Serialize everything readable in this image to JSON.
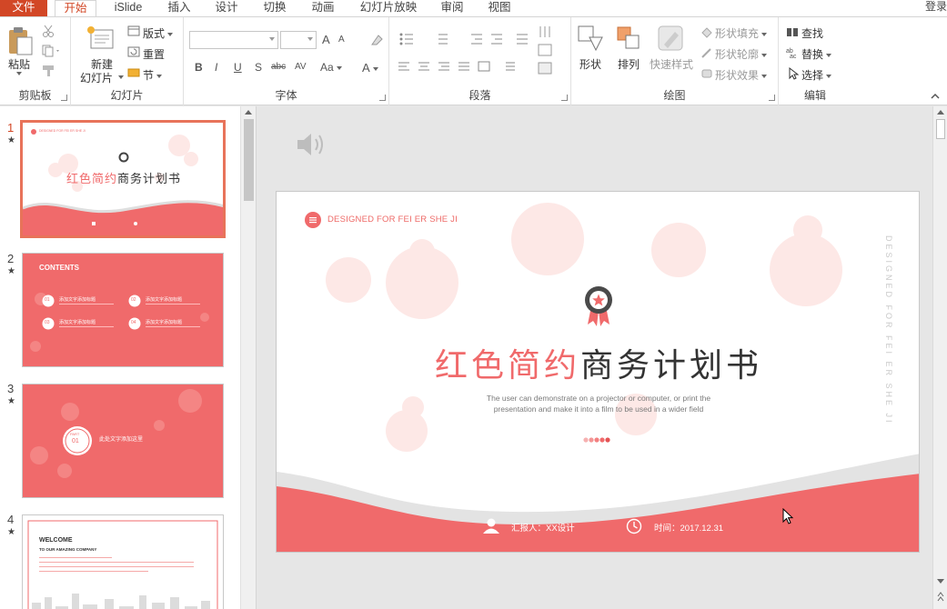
{
  "tabs": [
    "文件",
    "开始",
    "iSlide",
    "插入",
    "设计",
    "切换",
    "动画",
    "幻灯片放映",
    "审阅",
    "视图"
  ],
  "login": "登录",
  "ribbon": {
    "clipboard": {
      "paste": "粘贴",
      "label": "剪贴板"
    },
    "slides": {
      "new_slide": "新建",
      "new_slide2": "幻灯片",
      "layout": "版式",
      "reset": "重置",
      "section": "节",
      "label": "幻灯片"
    },
    "font": {
      "bold": "B",
      "italic": "I",
      "underline": "U",
      "shadow": "S",
      "strike": "abc",
      "spacing": "AV",
      "case": "Aa",
      "color": "A",
      "grow": "A",
      "shrink": "A",
      "label": "字体"
    },
    "paragraph": {
      "label": "段落"
    },
    "drawing": {
      "shape": "形状",
      "arrange": "排列",
      "quick_styles": "快速样式",
      "fill": "形状填充",
      "outline": "形状轮廓",
      "effects": "形状效果",
      "label": "绘图"
    },
    "editing": {
      "find": "查找",
      "replace": "替换",
      "select": "选择",
      "label": "编辑"
    }
  },
  "thumbnails": [
    {
      "num": "1",
      "star": "★",
      "designed": "DESIGNED FOR FEI ER SHE JI",
      "title_red": "红色简约",
      "title_dark": "商务计划书"
    },
    {
      "num": "2",
      "star": "★",
      "contents": "CONTENTS",
      "items": [
        "01",
        "02",
        "03",
        "04"
      ],
      "item_text": "添加文字添加标题"
    },
    {
      "num": "3",
      "star": "★",
      "part": "PART",
      "part_num": "01",
      "heading": "此处文字添加这里"
    },
    {
      "num": "4",
      "star": "★",
      "welcome": "WELCOME",
      "company": "TO OUR AMAZING COMPANY"
    }
  ],
  "slide": {
    "designed": "DESIGNED FOR FEI ER SHE JI",
    "vertical_text": "DESIGNED FOR FEI ER SHE JI",
    "title_red": "红色简约",
    "title_dark": "商务计划书",
    "subtitle_line1": "The user can demonstrate on a projector or computer, or print the",
    "subtitle_line2": "presentation and make it into a film to be used in a wider field",
    "reporter": "汇报人：XX设计",
    "time": "时间：2017.12.31"
  },
  "colors": {
    "accent": "#d24726",
    "slide_red": "#f06a6b",
    "pink_circle": "#fde8e6"
  },
  "icons": [
    "speaker-icon",
    "medal-icon",
    "person-icon",
    "clock-icon",
    "menu-icon"
  ]
}
